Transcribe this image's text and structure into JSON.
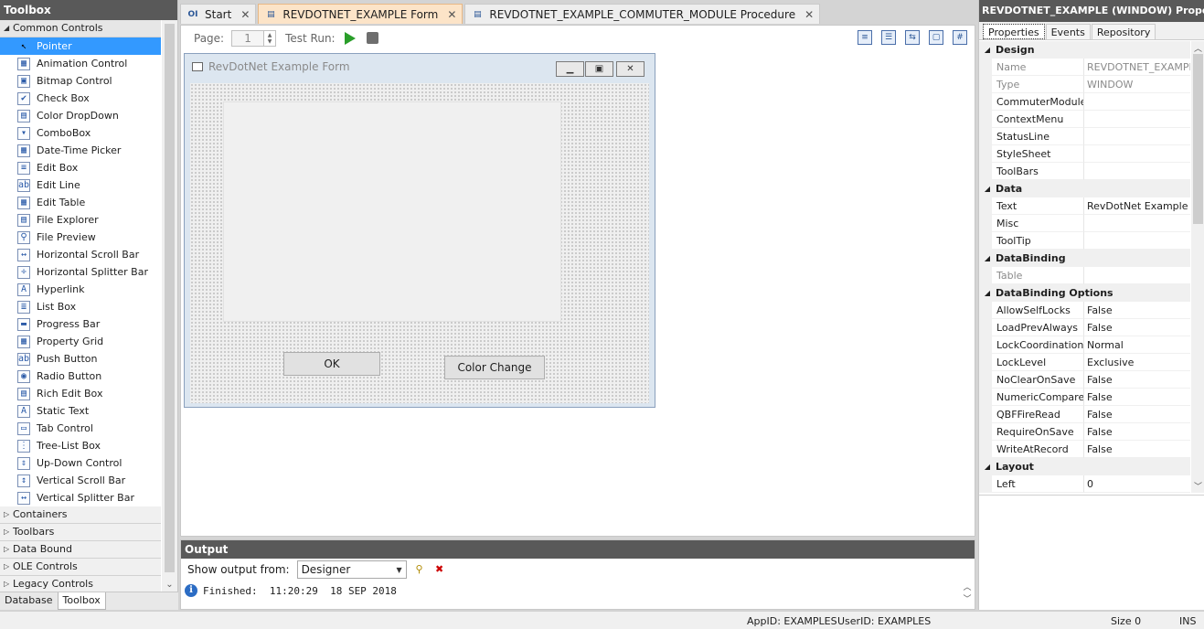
{
  "toolbox": {
    "title": "Toolbox",
    "categories_open": "Common Controls",
    "items": [
      {
        "label": "Pointer",
        "icon": "pointer-icon",
        "glyph": "↖"
      },
      {
        "label": "Animation Control",
        "icon": "animation-icon",
        "glyph": "▦"
      },
      {
        "label": "Bitmap Control",
        "icon": "bitmap-icon",
        "glyph": "▣"
      },
      {
        "label": "Check Box",
        "icon": "checkbox-icon",
        "glyph": "✔"
      },
      {
        "label": "Color DropDown",
        "icon": "color-dropdown-icon",
        "glyph": "▤"
      },
      {
        "label": "ComboBox",
        "icon": "combobox-icon",
        "glyph": "▾"
      },
      {
        "label": "Date-Time Picker",
        "icon": "datetime-icon",
        "glyph": "▦"
      },
      {
        "label": "Edit Box",
        "icon": "editbox-icon",
        "glyph": "≡"
      },
      {
        "label": "Edit Line",
        "icon": "editline-icon",
        "glyph": "ab"
      },
      {
        "label": "Edit Table",
        "icon": "edittable-icon",
        "glyph": "▦"
      },
      {
        "label": "File Explorer",
        "icon": "file-explorer-icon",
        "glyph": "▤"
      },
      {
        "label": "File Preview",
        "icon": "file-preview-icon",
        "glyph": "⚲"
      },
      {
        "label": "Horizontal Scroll Bar",
        "icon": "hscroll-icon",
        "glyph": "↔"
      },
      {
        "label": "Horizontal Splitter Bar",
        "icon": "hsplitter-icon",
        "glyph": "÷"
      },
      {
        "label": "Hyperlink",
        "icon": "hyperlink-icon",
        "glyph": "A"
      },
      {
        "label": "List Box",
        "icon": "listbox-icon",
        "glyph": "≣"
      },
      {
        "label": "Progress Bar",
        "icon": "progressbar-icon",
        "glyph": "▬"
      },
      {
        "label": "Property Grid",
        "icon": "propertygrid-icon",
        "glyph": "▦"
      },
      {
        "label": "Push Button",
        "icon": "pushbutton-icon",
        "glyph": "ab"
      },
      {
        "label": "Radio Button",
        "icon": "radiobutton-icon",
        "glyph": "◉"
      },
      {
        "label": "Rich Edit Box",
        "icon": "richedit-icon",
        "glyph": "▤"
      },
      {
        "label": "Static Text",
        "icon": "statictext-icon",
        "glyph": "A"
      },
      {
        "label": "Tab Control",
        "icon": "tabcontrol-icon",
        "glyph": "▭"
      },
      {
        "label": "Tree-List Box",
        "icon": "treelist-icon",
        "glyph": "⋮"
      },
      {
        "label": "Up-Down Control",
        "icon": "updown-icon",
        "glyph": "⇕"
      },
      {
        "label": "Vertical Scroll Bar",
        "icon": "vscroll-icon",
        "glyph": "↕"
      },
      {
        "label": "Vertical Splitter Bar",
        "icon": "vsplitter-icon",
        "glyph": "↔"
      }
    ],
    "collapsed": [
      "Containers",
      "Toolbars",
      "Data Bound",
      "OLE Controls",
      "Legacy Controls"
    ],
    "bottom_tabs": [
      "Database",
      "Toolbox"
    ]
  },
  "doc_tabs": [
    {
      "label": "Start",
      "icon": "start-icon",
      "glyph": "OI"
    },
    {
      "label": "REVDOTNET_EXAMPLE Form",
      "icon": "form-icon",
      "glyph": "▤"
    },
    {
      "label": "REVDOTNET_EXAMPLE_COMMUTER_MODULE Procedure",
      "icon": "procedure-icon",
      "glyph": "▤"
    }
  ],
  "designer": {
    "page_label": "Page:",
    "page_value": "1",
    "test_run_label": "Test Run:",
    "form": {
      "title": "RevDotNet Example Form",
      "ok_label": "OK",
      "color_change_label": "Color Change"
    }
  },
  "output": {
    "title": "Output",
    "show_from_label": "Show output from:",
    "source_value": "Designer",
    "line": "Finished:  11:20:29  18 SEP 2018"
  },
  "properties": {
    "title": "REVDOTNET_EXAMPLE (WINDOW) Properties",
    "tabs": [
      "Properties",
      "Events",
      "Repository"
    ],
    "groups": [
      {
        "name": "Design",
        "rows": [
          {
            "k": "Name",
            "v": "REVDOTNET_EXAMPLE",
            "ro": true
          },
          {
            "k": "Type",
            "v": "WINDOW",
            "ro": true
          },
          {
            "k": "CommuterModule",
            "v": ""
          },
          {
            "k": "ContextMenu",
            "v": ""
          },
          {
            "k": "StatusLine",
            "v": ""
          },
          {
            "k": "StyleSheet",
            "v": ""
          },
          {
            "k": "ToolBars",
            "v": ""
          }
        ]
      },
      {
        "name": "Data",
        "rows": [
          {
            "k": "Text",
            "v": "RevDotNet Example Form"
          },
          {
            "k": "Misc",
            "v": ""
          },
          {
            "k": "ToolTip",
            "v": ""
          }
        ]
      },
      {
        "name": "DataBinding",
        "rows": [
          {
            "k": "Table",
            "v": "",
            "ro": true
          }
        ]
      },
      {
        "name": "DataBinding Options",
        "rows": [
          {
            "k": "AllowSelfLocks",
            "v": "False"
          },
          {
            "k": "LoadPrevAlways",
            "v": "False"
          },
          {
            "k": "LockCoordination",
            "v": "Normal"
          },
          {
            "k": "LockLevel",
            "v": "Exclusive"
          },
          {
            "k": "NoClearOnSave",
            "v": "False"
          },
          {
            "k": "NumericCompare",
            "v": "False"
          },
          {
            "k": "QBFFireRead",
            "v": "False"
          },
          {
            "k": "RequireOnSave",
            "v": "False"
          },
          {
            "k": "WriteAtRecord",
            "v": "False"
          }
        ]
      },
      {
        "name": "Layout",
        "rows": [
          {
            "k": "Left",
            "v": "0"
          }
        ]
      }
    ]
  },
  "statusbar": {
    "appid": "AppID: EXAMPLES",
    "userid": "UserID: EXAMPLES",
    "size": "Size 0",
    "mode": "INS"
  }
}
